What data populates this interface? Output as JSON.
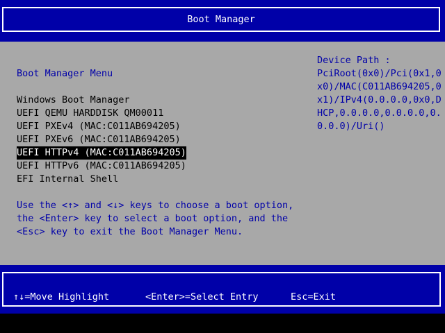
{
  "header": {
    "title": "Boot Manager"
  },
  "menu": {
    "heading": "Boot Manager Menu",
    "entries": [
      {
        "label": "Windows Boot Manager"
      },
      {
        "label": "UEFI QEMU HARDDISK QM00011"
      },
      {
        "label": "UEFI PXEv4 (MAC:C011AB694205)"
      },
      {
        "label": "UEFI PXEv6 (MAC:C011AB694205)"
      },
      {
        "label": "UEFI HTTPv4 (MAC:C011AB694205)"
      },
      {
        "label": "UEFI HTTPv6 (MAC:C011AB694205)"
      },
      {
        "label": "EFI Internal Shell"
      }
    ],
    "selected_entry": "UEFI HTTPv4 (MAC:C011AB694205)",
    "instructions": [
      "Use the <↑> and <↓> keys to choose a boot option,",
      "the <Enter> key to select a boot option, and the",
      "<Esc> key to exit the Boot Manager Menu."
    ]
  },
  "device_path": {
    "label": "Device Path :",
    "lines": [
      "PciRoot(0x0)/Pci(0x1,0",
      "x0)/MAC(C011AB694205,0",
      "x1)/IPv4(0.0.0.0,0x0,D",
      "HCP,0.0.0.0,0.0.0.0,0.",
      "0.0.0)/Uri()"
    ]
  },
  "help": {
    "move": "↑↓=Move Highlight",
    "select": "<Enter>=Select Entry",
    "exit": "Esc=Exit"
  },
  "colors": {
    "band_blue": "#0000a8",
    "panel_grey": "#a8a8a8",
    "text_blue": "#0000a8",
    "highlight_bg": "#000000",
    "highlight_fg": "#ffffff"
  }
}
